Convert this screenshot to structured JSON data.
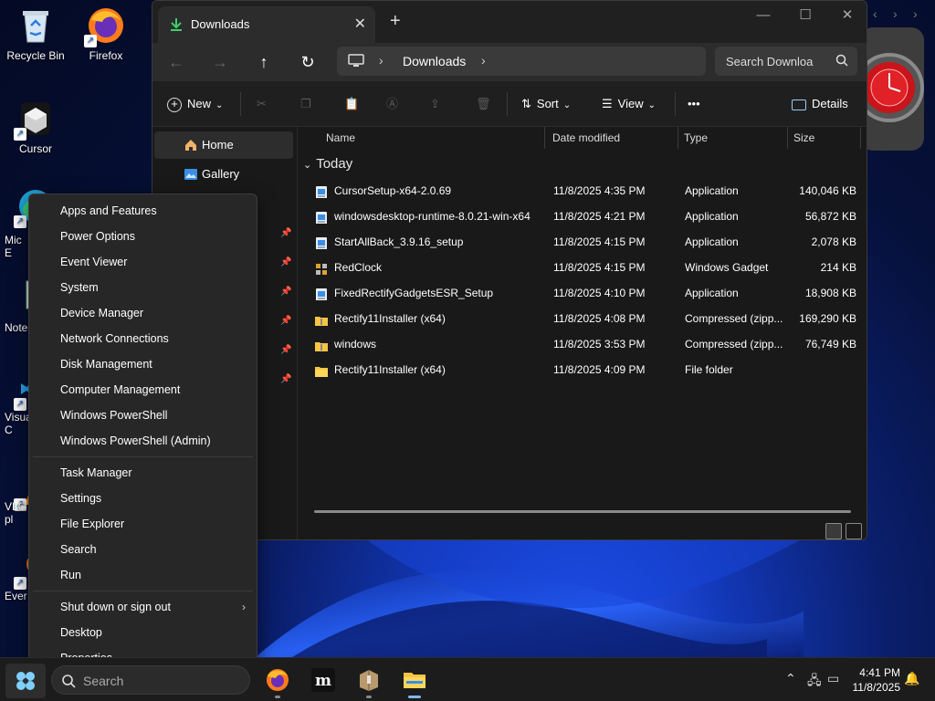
{
  "desktop": {
    "icons": [
      {
        "name": "recycle-bin",
        "label": "Recycle Bin"
      },
      {
        "name": "firefox",
        "label": "Firefox"
      },
      {
        "name": "cursor",
        "label": "Cursor"
      },
      {
        "name": "edge",
        "label": "Mic\nE"
      },
      {
        "name": "notepad",
        "label": "Note"
      },
      {
        "name": "vscode",
        "label": "Visua\nC"
      },
      {
        "name": "vlc",
        "label": "VLC\npl"
      },
      {
        "name": "everything",
        "label": "Ever"
      }
    ]
  },
  "explorer": {
    "tab_title": "Downloads",
    "address": {
      "crumb": "Downloads"
    },
    "search_placeholder": "Search Downloa",
    "commands": {
      "new": "New",
      "sort": "Sort",
      "view": "View",
      "more": "•••",
      "details": "Details"
    },
    "nav": {
      "home": "Home",
      "gallery": "Gallery"
    },
    "columns": {
      "name": "Name",
      "date": "Date modified",
      "type": "Type",
      "size": "Size"
    },
    "group": "Today",
    "files": [
      {
        "name": "CursorSetup-x64-2.0.69",
        "date": "11/8/2025 4:35 PM",
        "type": "Application",
        "size": "140,046 KB",
        "icon": "installer"
      },
      {
        "name": "windowsdesktop-runtime-8.0.21-win-x64",
        "date": "11/8/2025 4:21 PM",
        "type": "Application",
        "size": "56,872 KB",
        "icon": "installer"
      },
      {
        "name": "StartAllBack_3.9.16_setup",
        "date": "11/8/2025 4:15 PM",
        "type": "Application",
        "size": "2,078 KB",
        "icon": "installer"
      },
      {
        "name": "RedClock",
        "date": "11/8/2025 4:15 PM",
        "type": "Windows Gadget",
        "size": "214 KB",
        "icon": "gadget"
      },
      {
        "name": "FixedRectifyGadgetsESR_Setup",
        "date": "11/8/2025 4:10 PM",
        "type": "Application",
        "size": "18,908 KB",
        "icon": "installer"
      },
      {
        "name": "Rectify11Installer (x64)",
        "date": "11/8/2025 4:08 PM",
        "type": "Compressed (zipp...",
        "size": "169,290 KB",
        "icon": "zip"
      },
      {
        "name": "windows",
        "date": "11/8/2025 3:53 PM",
        "type": "Compressed (zipp...",
        "size": "76,749 KB",
        "icon": "zip"
      },
      {
        "name": "Rectify11Installer (x64)",
        "date": "11/8/2025 4:09 PM",
        "type": "File folder",
        "size": "",
        "icon": "folder"
      }
    ]
  },
  "context_menu": {
    "group1": [
      "Apps and Features",
      "Power Options",
      "Event Viewer",
      "System",
      "Device Manager",
      "Network Connections",
      "Disk Management",
      "Computer Management",
      "Windows PowerShell",
      "Windows PowerShell (Admin)"
    ],
    "group2": [
      "Task Manager",
      "Settings",
      "File Explorer",
      "Search",
      "Run"
    ],
    "group3": [
      "Shut down or sign out",
      "Desktop",
      "Properties"
    ]
  },
  "taskbar": {
    "search_placeholder": "Search",
    "time": "4:41 PM",
    "date": "11/8/2025"
  },
  "colors": {
    "accent": "#4aa3ff",
    "folder": "#f6c544"
  }
}
